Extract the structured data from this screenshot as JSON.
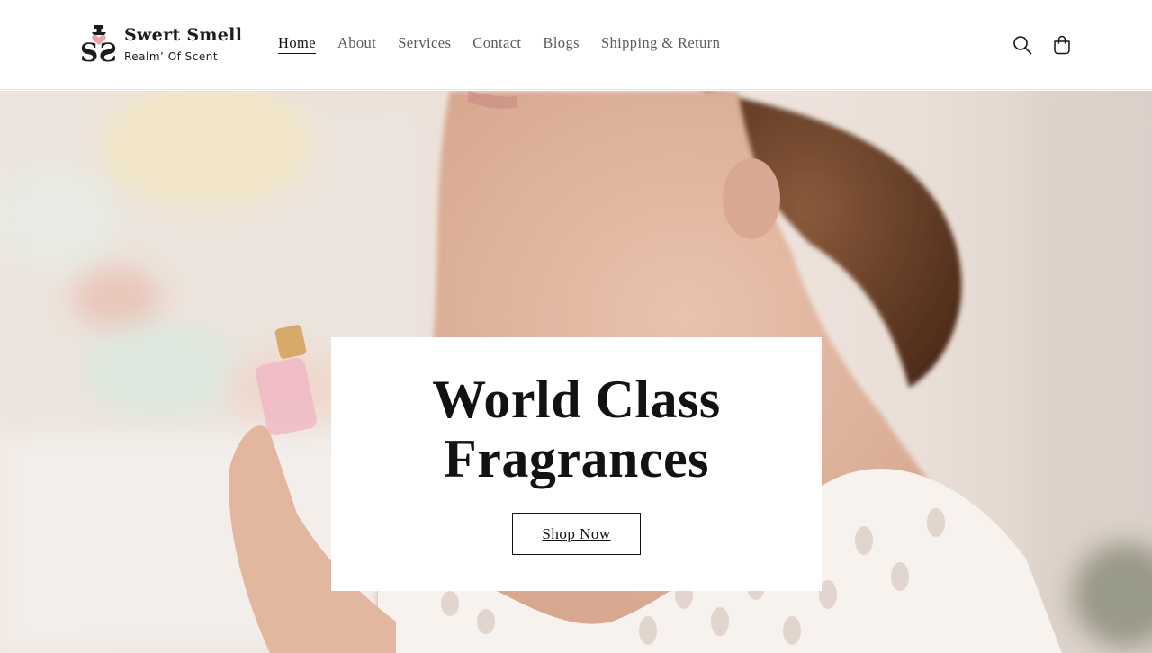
{
  "header": {
    "logo": {
      "name": "Swert Smell",
      "tagline": "Realm’ Of  Scent",
      "mark_letters": "SS",
      "accent_color": "#e9a3ab"
    },
    "nav": [
      {
        "label": "Home",
        "active": true
      },
      {
        "label": "About",
        "active": false
      },
      {
        "label": "Services",
        "active": false
      },
      {
        "label": "Contact",
        "active": false
      },
      {
        "label": "Blogs",
        "active": false
      },
      {
        "label": "Shipping & Return",
        "active": false
      }
    ],
    "icons": {
      "search": "search-icon",
      "cart": "shopping-bag-icon"
    }
  },
  "hero": {
    "image_subject": "woman-spraying-perfume",
    "heading_line1": "World Class",
    "heading_line2": "Fragrances",
    "button_label": "Shop Now"
  },
  "colors": {
    "text": "#121212",
    "nav_muted": "#5a5a5a",
    "background": "#ffffff",
    "border": "#e6e6e6"
  }
}
